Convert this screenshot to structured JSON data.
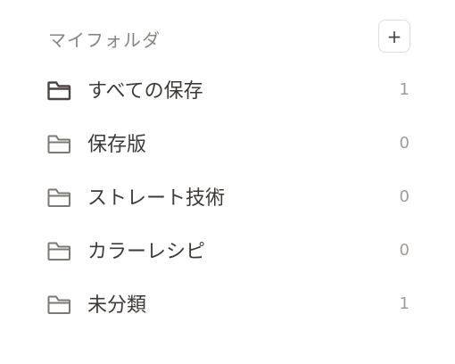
{
  "header": {
    "title": "マイフォルダ",
    "add_label": "+"
  },
  "folders": [
    {
      "label": "すべての保存",
      "count": "1",
      "icon": "folder-icon"
    },
    {
      "label": "保存版",
      "count": "0",
      "icon": "folder-icon"
    },
    {
      "label": "ストレート技術",
      "count": "0",
      "icon": "folder-icon"
    },
    {
      "label": "カラーレシピ",
      "count": "0",
      "icon": "folder-icon"
    },
    {
      "label": "未分類",
      "count": "1",
      "icon": "folder-icon"
    }
  ],
  "colors": {
    "title": "#8a857f",
    "label": "#3f3a36",
    "count": "#a19c96",
    "icon_active": "#4a4540",
    "icon": "#7d7872",
    "button_border": "#e0ddd8"
  }
}
